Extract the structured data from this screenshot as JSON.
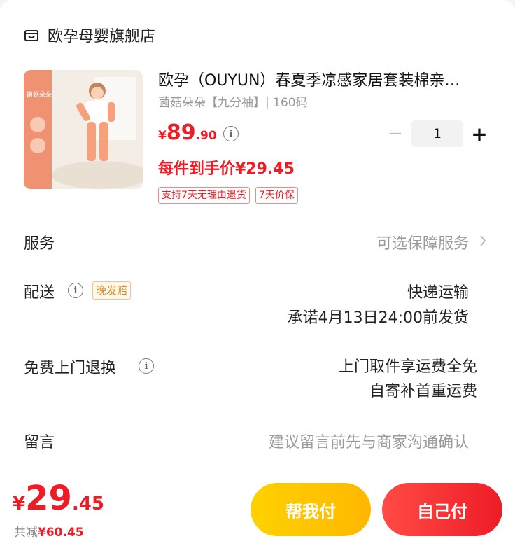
{
  "shop": {
    "icon": "store-icon",
    "name": "欧孕母婴旗舰店"
  },
  "product": {
    "title": "欧孕（OUYUN）春夏季凉感家居套装棉亲…",
    "sku": "菌菇朵朵【九分袖】| 160码",
    "price_currency": "¥",
    "price_int": "89",
    "price_dec": ".90",
    "final_price": "每件到手价¥29.45",
    "quantity": "1",
    "minus_label": "−",
    "plus_label": "+",
    "tags": [
      "支持7天无理由退货",
      "7天价保"
    ],
    "image_caption": "菌菇朵朵"
  },
  "rows": {
    "service": {
      "label": "服务",
      "value": "可选保障服务"
    },
    "delivery": {
      "label": "配送",
      "badge": "晚发赔",
      "method": "快递运输",
      "promise": "承诺4月13日24:00前发货"
    },
    "door_return": {
      "label": "免费上门退换",
      "line1": "上门取件享运费全免",
      "line2": "自寄补首重运费"
    },
    "message": {
      "label": "留言",
      "placeholder": "建议留言前先与商家沟通确认"
    }
  },
  "footer": {
    "currency": "¥",
    "total_int": "29",
    "total_dec": ".45",
    "saving_prefix": "共减",
    "saving_value": "¥60.45",
    "help_pay_label": "帮我付",
    "self_pay_label": "自己付"
  },
  "colors": {
    "accent_red": "#ee1c25",
    "accent_yellow": "#ffc400"
  }
}
